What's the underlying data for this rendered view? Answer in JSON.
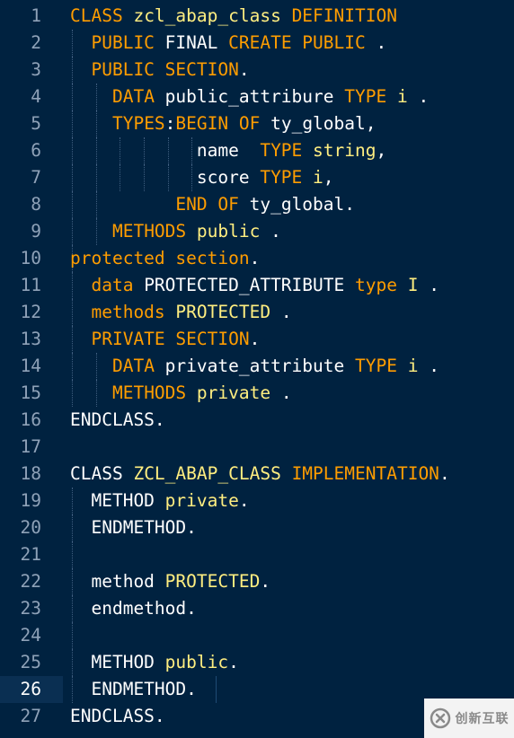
{
  "editor": {
    "current_line": 26,
    "lines": [
      {
        "n": "1",
        "tokens": [
          [
            "kw",
            "CLASS "
          ],
          [
            "id",
            "zcl_abap_class "
          ],
          [
            "kw",
            "DEFINITION"
          ]
        ]
      },
      {
        "n": "2",
        "tokens": [
          [
            "pl",
            "  "
          ],
          [
            "kw",
            "PUBLIC "
          ],
          [
            "pl",
            "FINAL "
          ],
          [
            "kw",
            "CREATE PUBLIC "
          ],
          [
            "pl",
            "."
          ]
        ]
      },
      {
        "n": "3",
        "tokens": [
          [
            "pl",
            "  "
          ],
          [
            "kw",
            "PUBLIC SECTION"
          ],
          [
            "pl",
            "."
          ]
        ]
      },
      {
        "n": "4",
        "tokens": [
          [
            "pl",
            "    "
          ],
          [
            "kw",
            "DATA "
          ],
          [
            "pl",
            "public_attribure "
          ],
          [
            "kw",
            "TYPE "
          ],
          [
            "id",
            "i "
          ],
          [
            "pl",
            "."
          ]
        ]
      },
      {
        "n": "5",
        "tokens": [
          [
            "pl",
            "    "
          ],
          [
            "kw",
            "TYPES"
          ],
          [
            "pl",
            ":"
          ],
          [
            "kw",
            "BEGIN OF "
          ],
          [
            "pl",
            "ty_global,"
          ]
        ]
      },
      {
        "n": "6",
        "tokens": [
          [
            "pl",
            "            name  "
          ],
          [
            "kw",
            "TYPE "
          ],
          [
            "id",
            "string"
          ],
          [
            "pl",
            ","
          ]
        ]
      },
      {
        "n": "7",
        "tokens": [
          [
            "pl",
            "            score "
          ],
          [
            "kw",
            "TYPE "
          ],
          [
            "id",
            "i"
          ],
          [
            "pl",
            ","
          ]
        ]
      },
      {
        "n": "8",
        "tokens": [
          [
            "pl",
            "          "
          ],
          [
            "kw",
            "END OF "
          ],
          [
            "pl",
            "ty_global."
          ]
        ]
      },
      {
        "n": "9",
        "tokens": [
          [
            "pl",
            "    "
          ],
          [
            "kw",
            "METHODS "
          ],
          [
            "id",
            "public "
          ],
          [
            "pl",
            "."
          ]
        ]
      },
      {
        "n": "10",
        "tokens": [
          [
            "kw",
            "protected section"
          ],
          [
            "pl",
            "."
          ]
        ]
      },
      {
        "n": "11",
        "tokens": [
          [
            "pl",
            "  "
          ],
          [
            "kw",
            "data "
          ],
          [
            "pl",
            "PROTECTED_ATTRIBUTE "
          ],
          [
            "kw",
            "type "
          ],
          [
            "id",
            "I "
          ],
          [
            "pl",
            "."
          ]
        ]
      },
      {
        "n": "12",
        "tokens": [
          [
            "pl",
            "  "
          ],
          [
            "kw",
            "methods "
          ],
          [
            "id",
            "PROTECTED "
          ],
          [
            "pl",
            "."
          ]
        ]
      },
      {
        "n": "13",
        "tokens": [
          [
            "pl",
            "  "
          ],
          [
            "kw",
            "PRIVATE SECTION"
          ],
          [
            "pl",
            "."
          ]
        ]
      },
      {
        "n": "14",
        "tokens": [
          [
            "pl",
            "    "
          ],
          [
            "kw",
            "DATA "
          ],
          [
            "pl",
            "private_attribute "
          ],
          [
            "kw",
            "TYPE "
          ],
          [
            "id",
            "i "
          ],
          [
            "pl",
            "."
          ]
        ]
      },
      {
        "n": "15",
        "tokens": [
          [
            "pl",
            "    "
          ],
          [
            "kw",
            "METHODS "
          ],
          [
            "id",
            "private "
          ],
          [
            "pl",
            "."
          ]
        ]
      },
      {
        "n": "16",
        "tokens": [
          [
            "pl",
            "ENDCLASS."
          ]
        ]
      },
      {
        "n": "17",
        "tokens": []
      },
      {
        "n": "18",
        "tokens": [
          [
            "pl",
            "CLASS "
          ],
          [
            "id",
            "ZCL_ABAP_CLASS "
          ],
          [
            "kw",
            "IMPLEMENTATION"
          ],
          [
            "pl",
            "."
          ]
        ]
      },
      {
        "n": "19",
        "tokens": [
          [
            "pl",
            "  METHOD "
          ],
          [
            "id",
            "private"
          ],
          [
            "pl",
            "."
          ]
        ]
      },
      {
        "n": "20",
        "tokens": [
          [
            "pl",
            "  ENDMETHOD."
          ]
        ]
      },
      {
        "n": "21",
        "tokens": []
      },
      {
        "n": "22",
        "tokens": [
          [
            "pl",
            "  method "
          ],
          [
            "id",
            "PROTECTED"
          ],
          [
            "pl",
            "."
          ]
        ]
      },
      {
        "n": "23",
        "tokens": [
          [
            "pl",
            "  endmethod."
          ]
        ]
      },
      {
        "n": "24",
        "tokens": []
      },
      {
        "n": "25",
        "tokens": [
          [
            "pl",
            "  METHOD "
          ],
          [
            "id",
            "public"
          ],
          [
            "pl",
            "."
          ]
        ]
      },
      {
        "n": "26",
        "tokens": [
          [
            "pl",
            "  ENDMETHOD."
          ]
        ]
      },
      {
        "n": "27",
        "tokens": [
          [
            "pl",
            "ENDCLASS."
          ]
        ]
      }
    ]
  },
  "watermark": {
    "label": "创新互联",
    "icon": "brand-logo-icon"
  }
}
